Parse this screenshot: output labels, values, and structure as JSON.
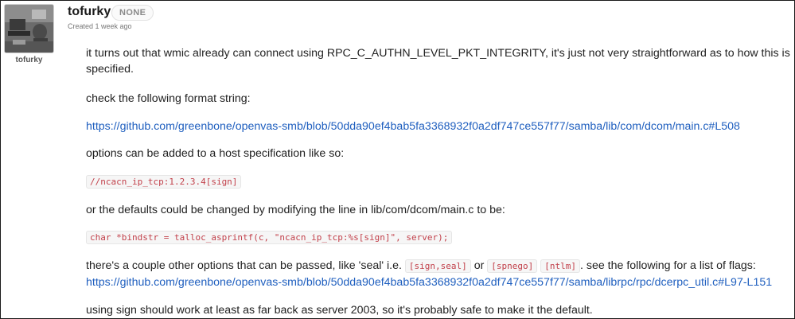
{
  "author": {
    "username": "tofurky",
    "role_badge": "NONE",
    "created": "Created 1 week ago",
    "avatar_caption": "tofurky"
  },
  "post": {
    "p1": "it turns out that wmic already can connect using RPC_C_AUTHN_LEVEL_PKT_INTEGRITY, it's just not very straightforward as to how this is specified.",
    "p2": "check the following format string:",
    "link1": "https://github.com/greenbone/openvas-smb/blob/50dda90ef4bab5fa3368932f0a2df747ce557f77/samba/lib/com/dcom/main.c#L508",
    "p3": "options can be added to a host specification like so:",
    "code1": "//ncacn_ip_tcp:1.2.3.4[sign]",
    "p4": "or the defaults could be changed by modifying the line in lib/com/dcom/main.c to be:",
    "code2": "char *bindstr = talloc_asprintf(c, \"ncacn_ip_tcp:%s[sign]\", server);",
    "p5_a": "there's a couple other options that can be passed, like 'seal' i.e.",
    "code3": "[sign,seal]",
    "p5_or": "or",
    "code4": "[spnego]",
    "code5": "[ntlm]",
    "p5_b": ". see the following for a list of flags:",
    "link2": "https://github.com/greenbone/openvas-smb/blob/50dda90ef4bab5fa3368932f0a2df747ce557f77/samba/librpc/rpc/dcerpc_util.c#L97-L151",
    "p6": "using sign should work at least as far back as server 2003, so it's probably safe to make it the default."
  },
  "colors": {
    "link": "#1f5fbf",
    "code_text": "#c2414b",
    "code_bg": "#f6f6f6"
  }
}
